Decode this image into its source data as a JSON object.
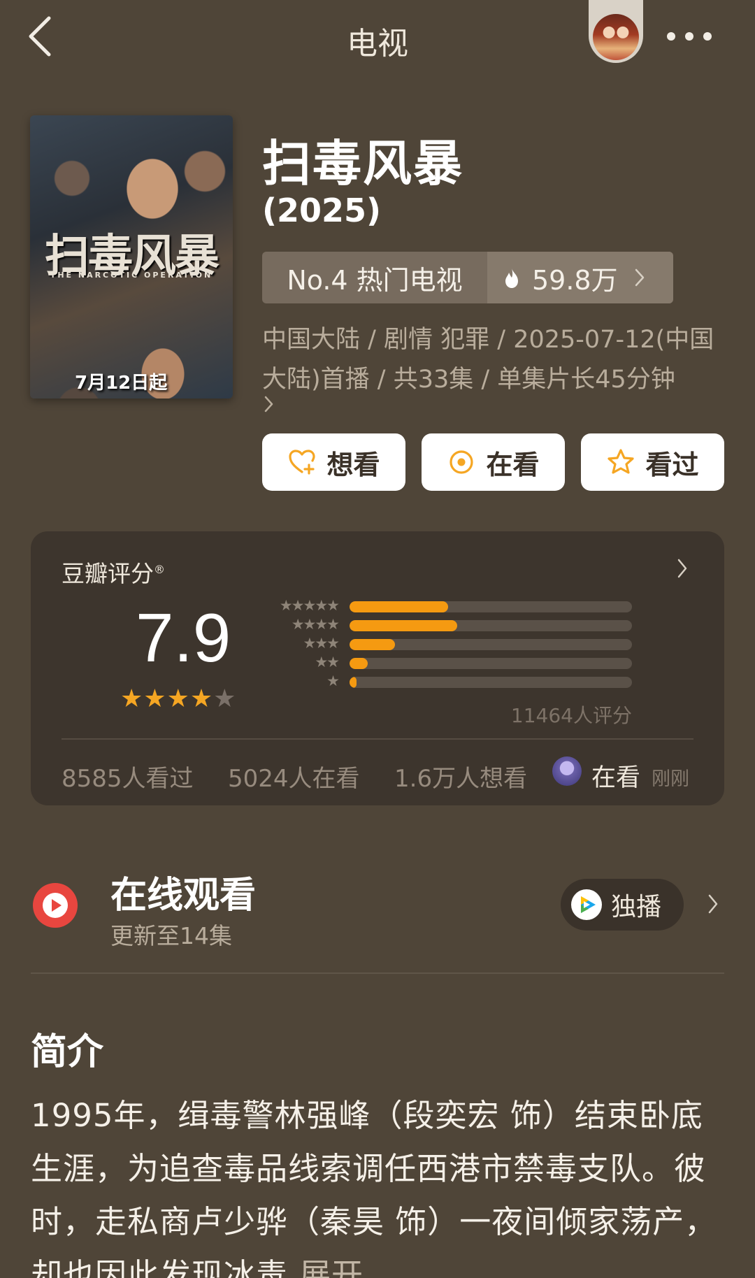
{
  "header": {
    "title": "电视"
  },
  "poster": {
    "title_text": "扫毒风暴",
    "subtitle_text": "THE NARCOTIC OPERATION",
    "date_text": "7月12日起"
  },
  "show": {
    "title": "扫毒风暴",
    "year": "(2025)",
    "rank_label": "No.4 热门电视",
    "heat_value": "59.8万",
    "meta": "中国大陆 / 剧情 犯罪 / 2025-07-12(中国大陆)首播 / 共33集 / 单集片长45分钟"
  },
  "actions": {
    "want": "想看",
    "watching": "在看",
    "watched": "看过"
  },
  "rating": {
    "label": "豆瓣评分",
    "label_mark": "®",
    "score": "7.9",
    "stars": 4,
    "star_glyph": "★",
    "rows": [
      {
        "stars": "★★★★★",
        "fraction": 0.35
      },
      {
        "stars": "★★★★",
        "fraction": 0.38
      },
      {
        "stars": "★★★",
        "fraction": 0.16
      },
      {
        "stars": "★★",
        "fraction": 0.065
      },
      {
        "stars": "★",
        "fraction": 0.025
      }
    ],
    "count_text": "11464人评分",
    "stats": {
      "watched": "8585人看过",
      "watching": "5024人在看",
      "want": "1.6万人想看"
    },
    "friend_status": "在看",
    "friend_time": "刚刚"
  },
  "online": {
    "title": "在线观看",
    "subtitle": "更新至14集",
    "badge": "独播"
  },
  "intro": {
    "title": "简介",
    "text": "1995年，缉毒警林强峰（段奕宏 饰）结束卧底生涯，为追查毒品线索调任西港市禁毒支队。彼时，走私商卢少骅（秦昊 饰）一夜间倾家荡产，却也因此发现冰毒",
    "expand": "展开"
  },
  "colors": {
    "background": "#4f4538",
    "accent_orange": "#f59a11",
    "card_bg": "#3d352d",
    "play_red": "#e8463f"
  },
  "icons": [
    "back-icon",
    "more-icon",
    "fire-icon",
    "heart-plus-icon",
    "target-icon",
    "star-outline-icon",
    "chevron-right-icon",
    "play-icon",
    "tencent-video-icon"
  ]
}
